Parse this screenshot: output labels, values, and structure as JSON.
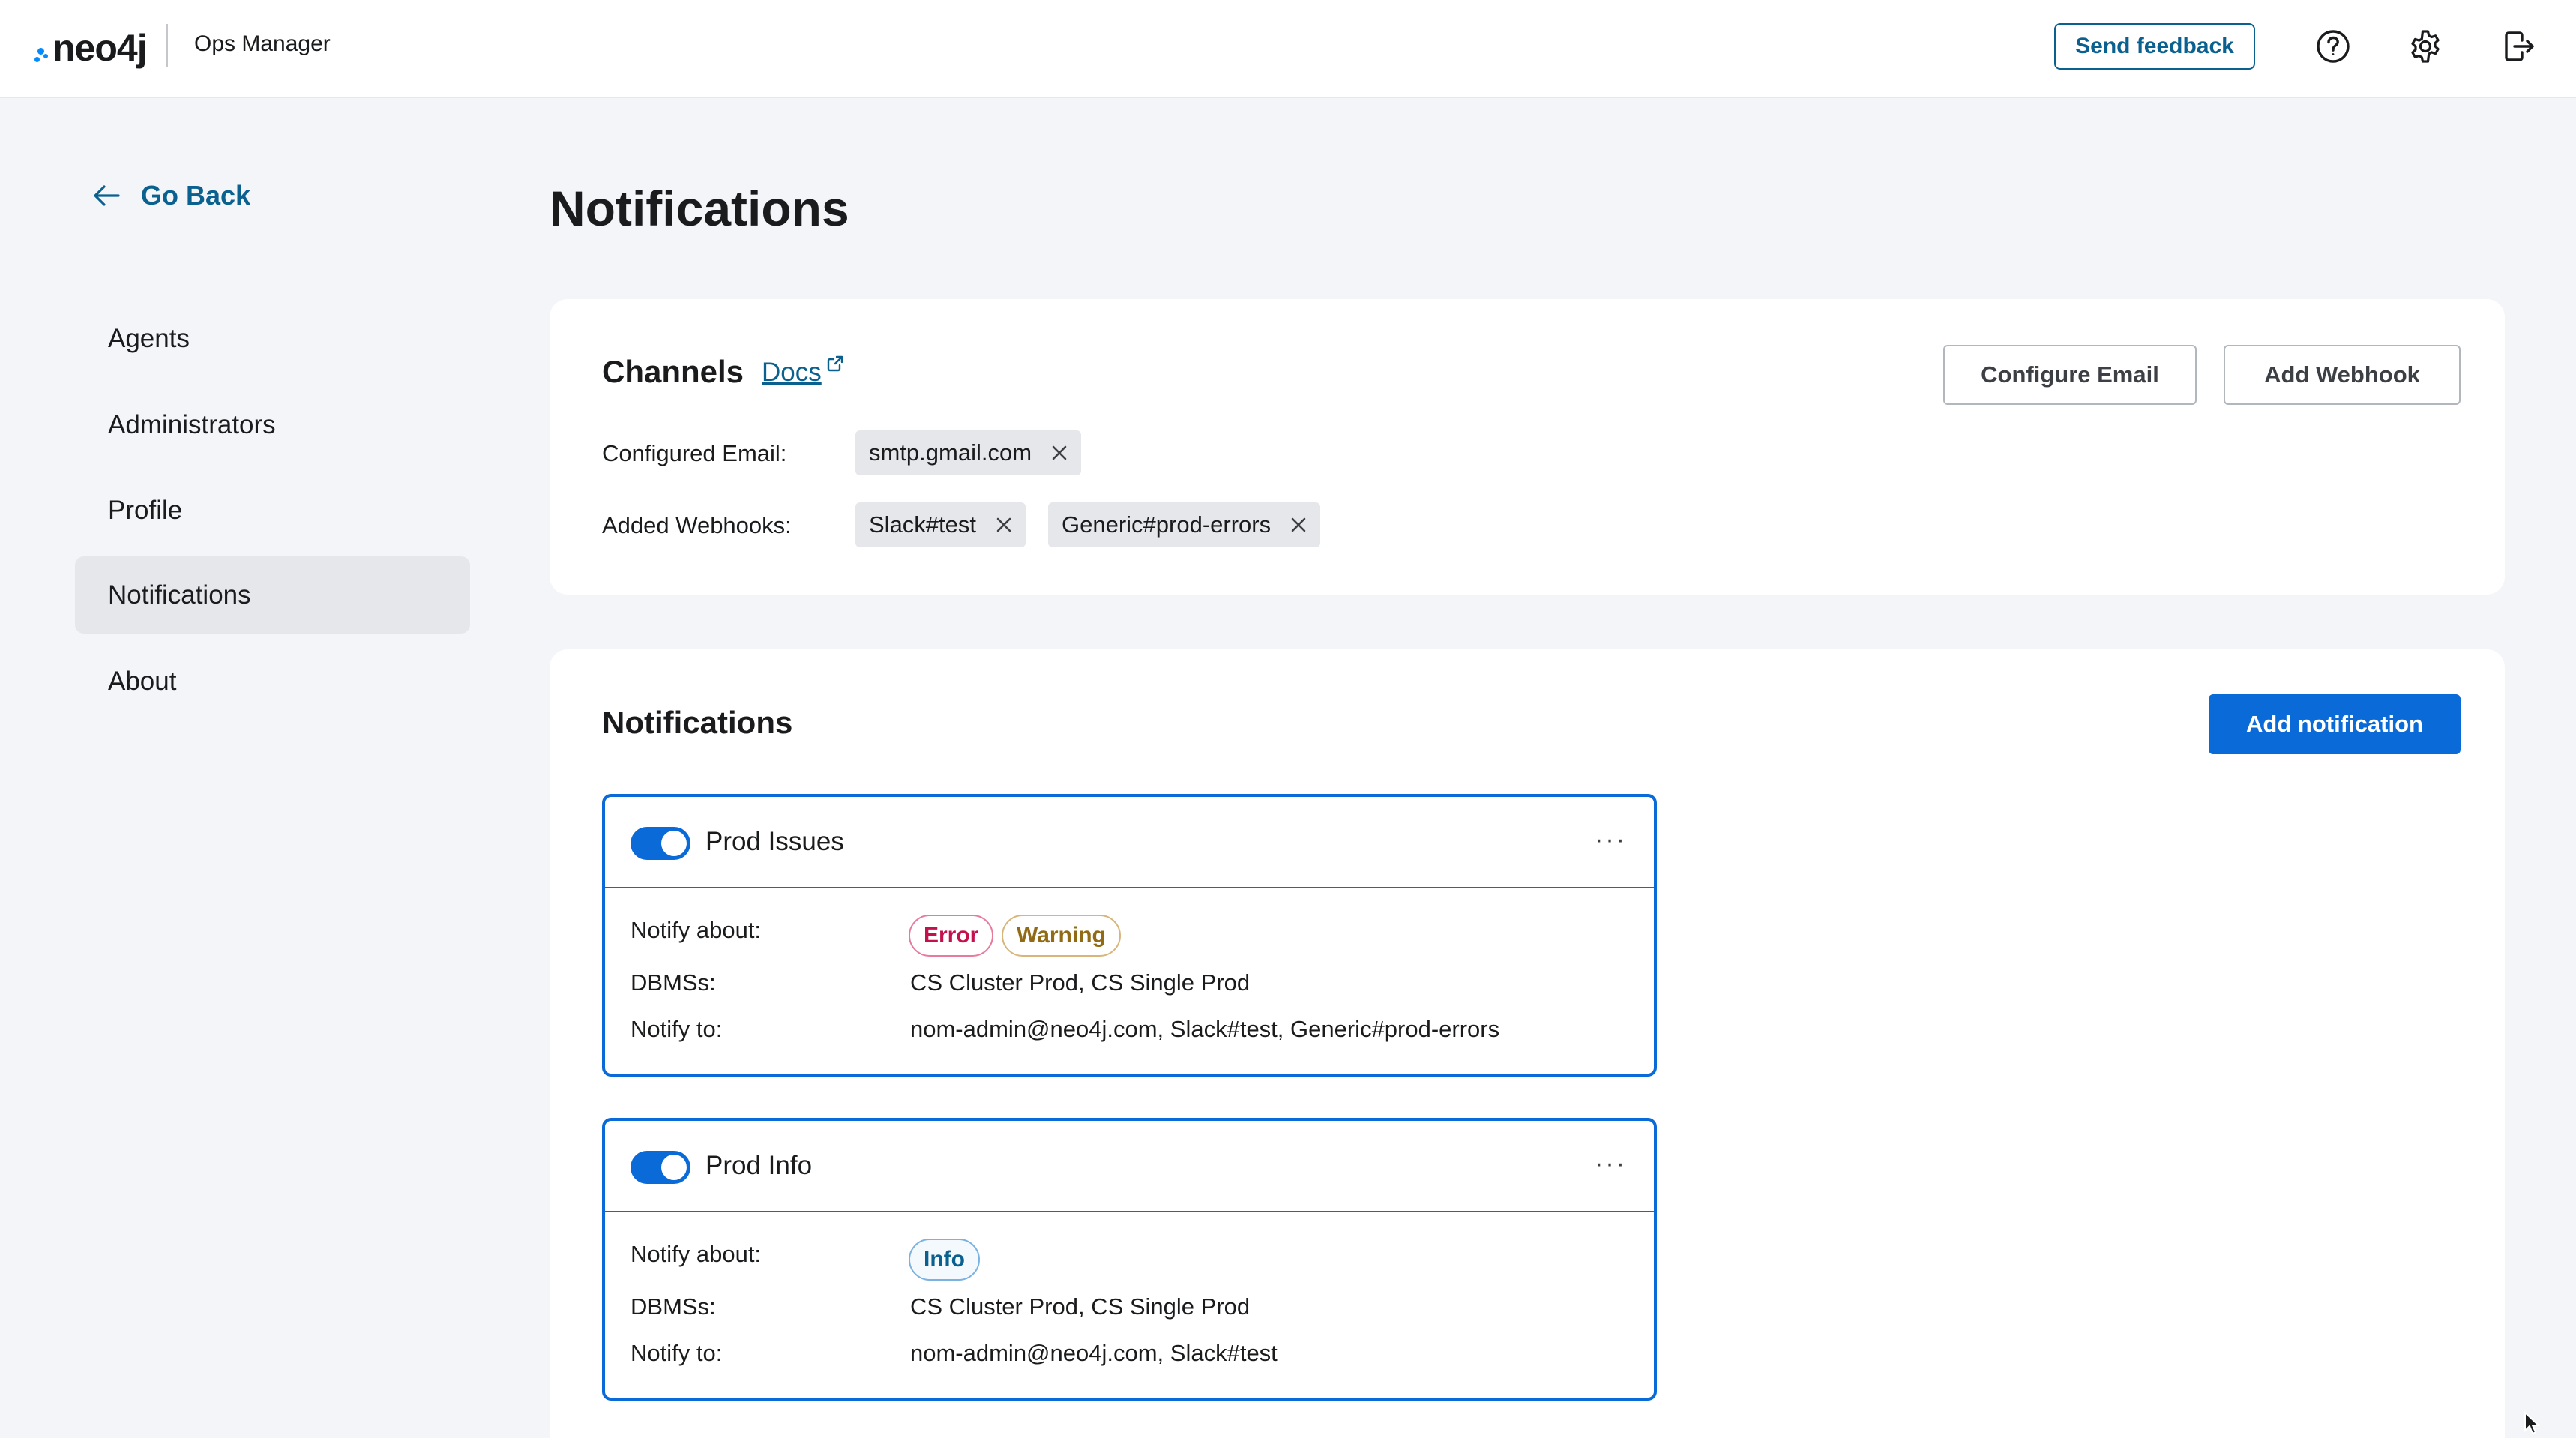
{
  "header": {
    "logo_text": "neo4j",
    "app_name": "Ops Manager",
    "feedback_label": "Send feedback",
    "icons": [
      "help-icon",
      "settings-icon",
      "logout-icon"
    ]
  },
  "sidebar": {
    "back_label": "Go Back",
    "items": [
      {
        "label": "Agents"
      },
      {
        "label": "Administrators"
      },
      {
        "label": "Profile"
      },
      {
        "label": "Notifications",
        "active": true
      },
      {
        "label": "About"
      }
    ]
  },
  "page": {
    "title": "Notifications"
  },
  "channels": {
    "title": "Channels",
    "docs_label": "Docs",
    "configure_email_label": "Configure Email",
    "add_webhook_label": "Add Webhook",
    "email_label": "Configured Email:",
    "emails": [
      "smtp.gmail.com"
    ],
    "webhooks_label": "Added Webhooks:",
    "webhooks": [
      "Slack#test",
      "Generic#prod-errors"
    ]
  },
  "notifications": {
    "title": "Notifications",
    "add_label": "Add notification",
    "labels": {
      "notify_about": "Notify about:",
      "dbmss": "DBMSs:",
      "notify_to": "Notify to:"
    },
    "rules": [
      {
        "name": "Prod Issues",
        "enabled": true,
        "levels": [
          "Error",
          "Warning"
        ],
        "dbmss": "CS Cluster Prod, CS Single Prod",
        "notify_to": "nom-admin@neo4j.com, Slack#test, Generic#prod-errors"
      },
      {
        "name": "Prod Info",
        "enabled": true,
        "levels": [
          "Info"
        ],
        "dbmss": "CS Cluster Prod, CS Single Prod",
        "notify_to": "nom-admin@neo4j.com, Slack#test"
      }
    ]
  },
  "colors": {
    "primary": "#0a6ad8",
    "link": "#0a6190",
    "error": "#c4104d",
    "warning": "#916a15"
  }
}
